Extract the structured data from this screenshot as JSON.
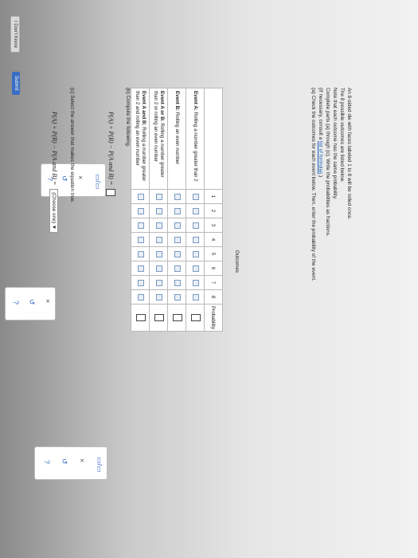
{
  "intro": [
    "An 8-sided die with faces labeled 1 to 8 will be rolled once.",
    "The 8 possible outcomes are listed below.",
    "Note that each outcome has the same probability.",
    "Complete parts (a) through (c). Write the probabilities as fractions.",
    "(If necessary, consult a ",
    "list of formulas",
    ".)"
  ],
  "part_a": "(a) Check the outcomes for each event below. Then, enter the probability of the event.",
  "table": {
    "outcomes_header": "Outcomes",
    "probability_header": "Probability",
    "outcomes": [
      "1",
      "2",
      "3",
      "4",
      "5",
      "6",
      "7",
      "8"
    ],
    "events": [
      {
        "label_bold": "Event A:",
        "label": " Rolling a number greater than 2"
      },
      {
        "label_bold": "Event B:",
        "label": " Rolling an even number"
      },
      {
        "label_bold": "Event A or B:",
        "label": " Rolling a number greater than 2 or rolling an even number"
      },
      {
        "label_bold": "Event A and B:",
        "label": " Rolling a number greater than 2 and rolling an even number"
      }
    ]
  },
  "part_b": "(b) Compute the following.",
  "formula_b": "P(A) + P(B) − P(A and B) =",
  "part_c": "(c) Select the answer that makes the equation true.",
  "formula_c": "P(A) + P(B) − P(A and B) =",
  "choose": "(Choose one) ▼",
  "tools": {
    "fraction": "▭/▭",
    "clear": "×",
    "undo": "↺",
    "help": "?"
  },
  "buttons": {
    "dont_know": "I Don't Know",
    "submit": "Submit"
  },
  "colors": {
    "submit": "#3a6ec4",
    "link": "#1a5fb4"
  }
}
